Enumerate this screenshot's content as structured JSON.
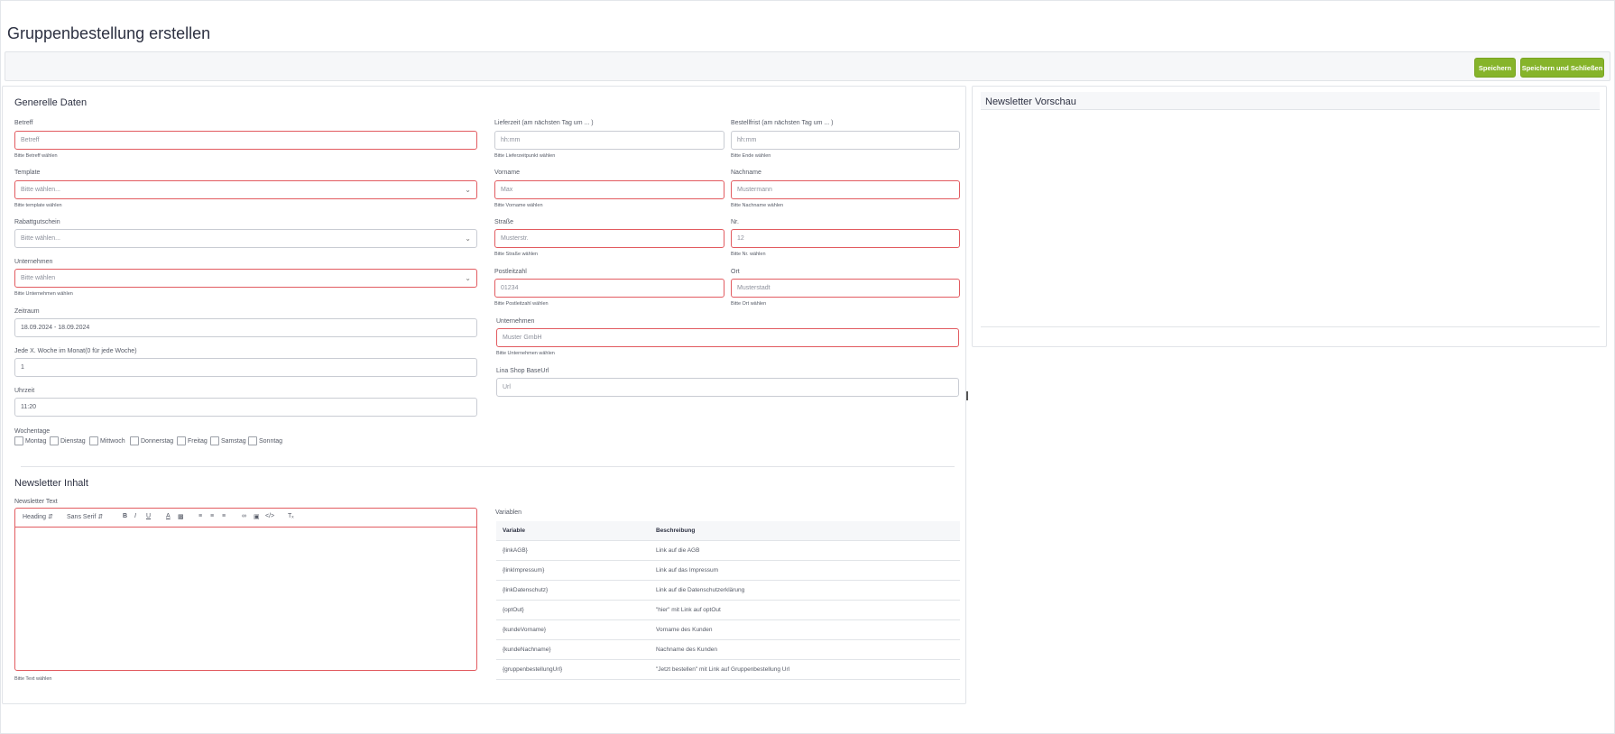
{
  "page": {
    "title": "Gruppenbestellung erstellen"
  },
  "toolbar": {
    "save_label": "Speichern",
    "save_close_label": "Speichern und Schließen"
  },
  "general": {
    "title": "Generelle Daten",
    "betreff": {
      "label": "Betreff",
      "placeholder": "Betreff",
      "hint": "Bitte Betreff wählen"
    },
    "template": {
      "label": "Template",
      "value": "Bitte wählen...",
      "hint": "Bitte template wählen"
    },
    "rabatt": {
      "label": "Rabattgutschein",
      "value": "Bitte wählen..."
    },
    "unternehmen_select": {
      "label": "Unternehmen",
      "value": "Bitte wählen",
      "hint": "Bitte Unternehmen wählen"
    },
    "zeitraum": {
      "label": "Zeitraum",
      "value": "18.09.2024 - 18.09.2024"
    },
    "woche": {
      "label": "Jede X. Woche im Monat(0 für jede Woche)",
      "value": "1"
    },
    "uhrzeit": {
      "label": "Uhrzeit",
      "value": "11:20"
    },
    "wochentage": {
      "label": "Wochentage",
      "days": [
        "Montag",
        "Dienstag",
        "Mittwoch",
        "Donnerstag",
        "Freitag",
        "Samstag",
        "Sonntag"
      ]
    },
    "lieferzeit": {
      "label": "Lieferzeit (am nächsten Tag um ... )",
      "placeholder": "hh:mm",
      "hint": "Bitte Lieferzeitpunkt wählen"
    },
    "bestellfrist": {
      "label": "Bestellfrist (am nächsten Tag um ... )",
      "placeholder": "hh:mm",
      "hint": "Bitte Ende wählen"
    },
    "vorname": {
      "label": "Vorname",
      "placeholder": "Max",
      "hint": "Bitte Vorname wählen"
    },
    "nachname": {
      "label": "Nachname",
      "placeholder": "Mustermann",
      "hint": "Bitte Nachname wählen"
    },
    "strasse": {
      "label": "Straße",
      "placeholder": "Musterstr.",
      "hint": "Bitte Straße wählen"
    },
    "nr": {
      "label": "Nr.",
      "placeholder": "12",
      "hint": "Bitte Nr. wählen"
    },
    "plz": {
      "label": "Postleitzahl",
      "placeholder": "01234",
      "hint": "Bitte Postleitzahl wählen"
    },
    "ort": {
      "label": "Ort",
      "placeholder": "Musterstadt",
      "hint": "Bitte Ort wählen"
    },
    "unternehmen_input": {
      "label": "Unternehmen",
      "placeholder": "Muster GmbH",
      "hint": "Bitte Unternehmen wählen"
    },
    "shop_url": {
      "label": "Lina Shop BaseUrl",
      "placeholder": "Url"
    }
  },
  "newsletter": {
    "title": "Newsletter Inhalt",
    "text_label": "Newsletter Text",
    "text_hint": "Bitte Text wählen",
    "toolbar": {
      "heading": "Heading",
      "font": "Sans Serif"
    },
    "variables_label": "Variablen",
    "table_headers": [
      "Variable",
      "Beschreibung"
    ],
    "variables": [
      [
        "{linkAGB}",
        "Link auf die AGB"
      ],
      [
        "{linkImpressum}",
        "Link auf das Impressum"
      ],
      [
        "{linkDatenschutz}",
        "Link auf die Datenschutzerklärung"
      ],
      [
        "{optOut}",
        "\"hier\" mit Link auf optOut"
      ],
      [
        "{kundeVorname}",
        "Vorname des Kunden"
      ],
      [
        "{kundeNachname}",
        "Nachname des Kunden"
      ],
      [
        "{gruppenbestellungUrl}",
        "\"Jetzt bestellen\" mit Link auf Gruppenbestellung Url"
      ]
    ]
  },
  "preview": {
    "title": "Newsletter Vorschau"
  },
  "colors": {
    "accent": "#86b42a",
    "error": "#e25b60"
  }
}
